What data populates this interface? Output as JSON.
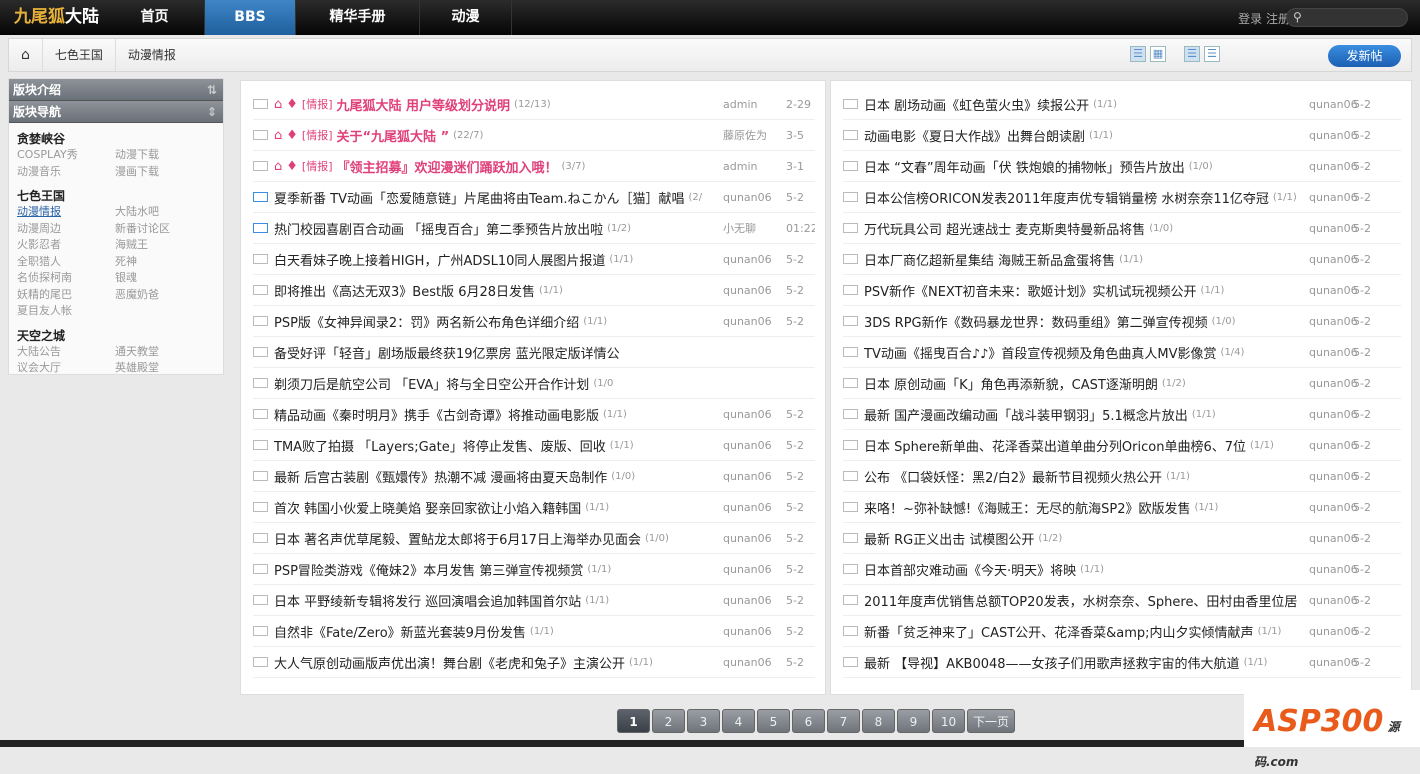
{
  "topbar": {
    "logo": "九尾狐",
    "logo2": "大陆",
    "nav": [
      "首页",
      "BBS",
      "精华手册",
      "动漫"
    ],
    "login": "登录",
    "register": "注册"
  },
  "breadcrumb": [
    "七色王国",
    "动漫情报"
  ],
  "new_post": "发新帖",
  "sidebar": {
    "h1": "版块介绍",
    "h2": "版块导航",
    "groups": [
      {
        "title": "贪婪峡谷",
        "items": [
          "COSPLAY秀",
          "动漫下载",
          "动漫音乐",
          "漫画下载"
        ]
      },
      {
        "title": "七色王国",
        "items": [
          "动漫情报",
          "大陆水吧",
          "动漫周边",
          "新番讨论区",
          "火影忍者",
          "海贼王",
          "全职猎人",
          "死神",
          "名侦探柯南",
          "银魂",
          "妖精的尾巴",
          "恶魔奶爸",
          "夏目友人帐"
        ]
      },
      {
        "title": "天空之城",
        "items": [
          "大陆公告",
          "通天教堂",
          "议会大厅",
          "英雄殿堂"
        ]
      }
    ]
  },
  "left": [
    {
      "tag": "[情报]",
      "t": "九尾狐大陆 用户等级划分说明",
      "c": "(12/13)",
      "a": "admin",
      "d": "2-29",
      "hot": true
    },
    {
      "tag": "[情报]",
      "t": "关于“九尾狐大陆 ”",
      "c": "(22/7)",
      "a": "藤原佐为",
      "d": "3-5",
      "hot": true
    },
    {
      "tag": "[情报]",
      "t": "『领主招募』欢迎漫迷们踊跃加入哦！",
      "c": "(3/7)",
      "a": "admin",
      "d": "3-1",
      "hot": true
    },
    {
      "t": "夏季新番 TV动画「恋爱随意链」片尾曲将由Team.ねこかん［猫］献唱",
      "c": "(2/",
      "a": "qunan06",
      "d": "5-2",
      "blue": true
    },
    {
      "t": "热门校园喜剧百合动画 「摇曳百合」第二季预告片放出啦",
      "c": "(1/2)",
      "a": "小无聊",
      "d": "01:22",
      "blue": true
    },
    {
      "t": "白天看妹子晚上接着HIGH，广州ADSL10同人展图片报道",
      "c": "(1/1)",
      "a": "qunan06",
      "d": "5-2"
    },
    {
      "t": "即将推出《高达无双3》Best版 6月28日发售",
      "c": "(1/1)",
      "a": "qunan06",
      "d": "5-2"
    },
    {
      "t": "PSP版《女神异闻录2：罚》两名新公布角色详细介绍",
      "c": "(1/1)",
      "a": "qunan06",
      "d": "5-2"
    },
    {
      "t": "备受好评「轻音」剧场版最终获19亿票房 蓝光限定版详情公"
    },
    {
      "t": "剃须刀后是航空公司 「EVA」将与全日空公开合作计划",
      "c": "(1/0"
    },
    {
      "t": "精品动画《秦时明月》携手《古剑奇谭》将推动画电影版",
      "c": "(1/1)",
      "a": "qunan06",
      "d": "5-2"
    },
    {
      "t": "TMA败了拍摄 「Layers;Gate」将停止发售、废版、回收",
      "c": "(1/1)",
      "a": "qunan06",
      "d": "5-2"
    },
    {
      "t": "最新 后宫古装剧《甄嬛传》热潮不减 漫画将由夏天岛制作",
      "c": "(1/0)",
      "a": "qunan06",
      "d": "5-2"
    },
    {
      "t": "首次 韩国小伙爱上晓美焰 娶亲回家欲让小焰入籍韩国",
      "c": "(1/1)",
      "a": "qunan06",
      "d": "5-2"
    },
    {
      "t": "日本 著名声优草尾毅、置鲇龙太郎将于6月17日上海举办见面会",
      "c": "(1/0)",
      "a": "qunan06",
      "d": "5-2"
    },
    {
      "t": "PSP冒险类游戏《俺妹2》本月发售 第三弹宣传视频赏",
      "c": "(1/1)",
      "a": "qunan06",
      "d": "5-2"
    },
    {
      "t": "日本 平野绫新专辑将发行 巡回演唱会追加韩国首尔站",
      "c": "(1/1)",
      "a": "qunan06",
      "d": "5-2"
    },
    {
      "t": "自然非《Fate/Zero》新蓝光套装9月份发售",
      "c": "(1/1)",
      "a": "qunan06",
      "d": "5-2"
    },
    {
      "t": "大人气原创动画版声优出演！舞台剧《老虎和兔子》主演公开",
      "c": "(1/1)",
      "a": "qunan06",
      "d": "5-2"
    }
  ],
  "right": [
    {
      "t": "日本 剧场动画《虹色萤火虫》续报公开",
      "c": "(1/1)"
    },
    {
      "t": "动画电影《夏日大作战》出舞台朗读剧",
      "c": "(1/1)"
    },
    {
      "t": "日本 “文春”周年动画「伏 铁炮娘的捕物帐」预告片放出",
      "c": "(1/0)"
    },
    {
      "t": "日本公信榜ORICON发表2011年度声优专辑销量榜 水树奈奈11亿夺冠",
      "c": "(1/1)"
    },
    {
      "t": "万代玩具公司 超光速战士 麦克斯奥特曼新品将售",
      "c": "(1/0)"
    },
    {
      "t": "日本厂商亿超新星集结 海贼王新品盒蛋将售",
      "c": "(1/1)"
    },
    {
      "t": "PSV新作《NEXT初音未来：歌姬计划》实机试玩视频公开",
      "c": "(1/1)"
    },
    {
      "t": "3DS RPG新作《数码暴龙世界：数码重组》第二弹宣传视频",
      "c": "(1/0)"
    },
    {
      "t": "TV动画《摇曳百合♪♪》首段宣传视频及角色曲真人MV影像赏",
      "c": "(1/4)"
    },
    {
      "t": "日本 原创动画「K」角色再添新貌，CAST逐渐明朗",
      "c": "(1/2)"
    },
    {
      "t": "最新 国产漫画改编动画「战斗装甲钢羽」5.1概念片放出",
      "c": "(1/1)"
    },
    {
      "t": "日本 Sphere新单曲、花泽香菜出道单曲分列Oricon单曲榜6、7位",
      "c": "(1/1)"
    },
    {
      "t": "公布 《口袋妖怪：黑2/白2》最新节目视频火热公开",
      "c": "(1/1)"
    },
    {
      "t": "来咯！~弥补缺憾!《海贼王：无尽的航海SP2》欧版发售",
      "c": "(1/1)"
    },
    {
      "t": "最新 RG正义出击 试模图公开",
      "c": "(1/2)"
    },
    {
      "t": "日本首部灾难动画《今天·明天》将映",
      "c": "(1/1)"
    },
    {
      "t": "2011年度声优销售总额TOP20发表，水树奈奈、Sphere、田村由香里位居"
    },
    {
      "t": "新番「贫乏神来了」CAST公开、花泽香菜&amp;内山夕实倾情献声",
      "c": "(1/1)"
    },
    {
      "t": "最新 【导视】AKB0048——女孩子们用歌声拯救宇宙的伟大航道",
      "c": "(1/1)"
    }
  ],
  "right_author": "qunan06",
  "right_date": "5-2",
  "pager": [
    "1",
    "2",
    "3",
    "4",
    "5",
    "6",
    "7",
    "8",
    "9",
    "10",
    "下一页"
  ],
  "watermark": "ASP300",
  "watermark_sub": "源码 .com"
}
